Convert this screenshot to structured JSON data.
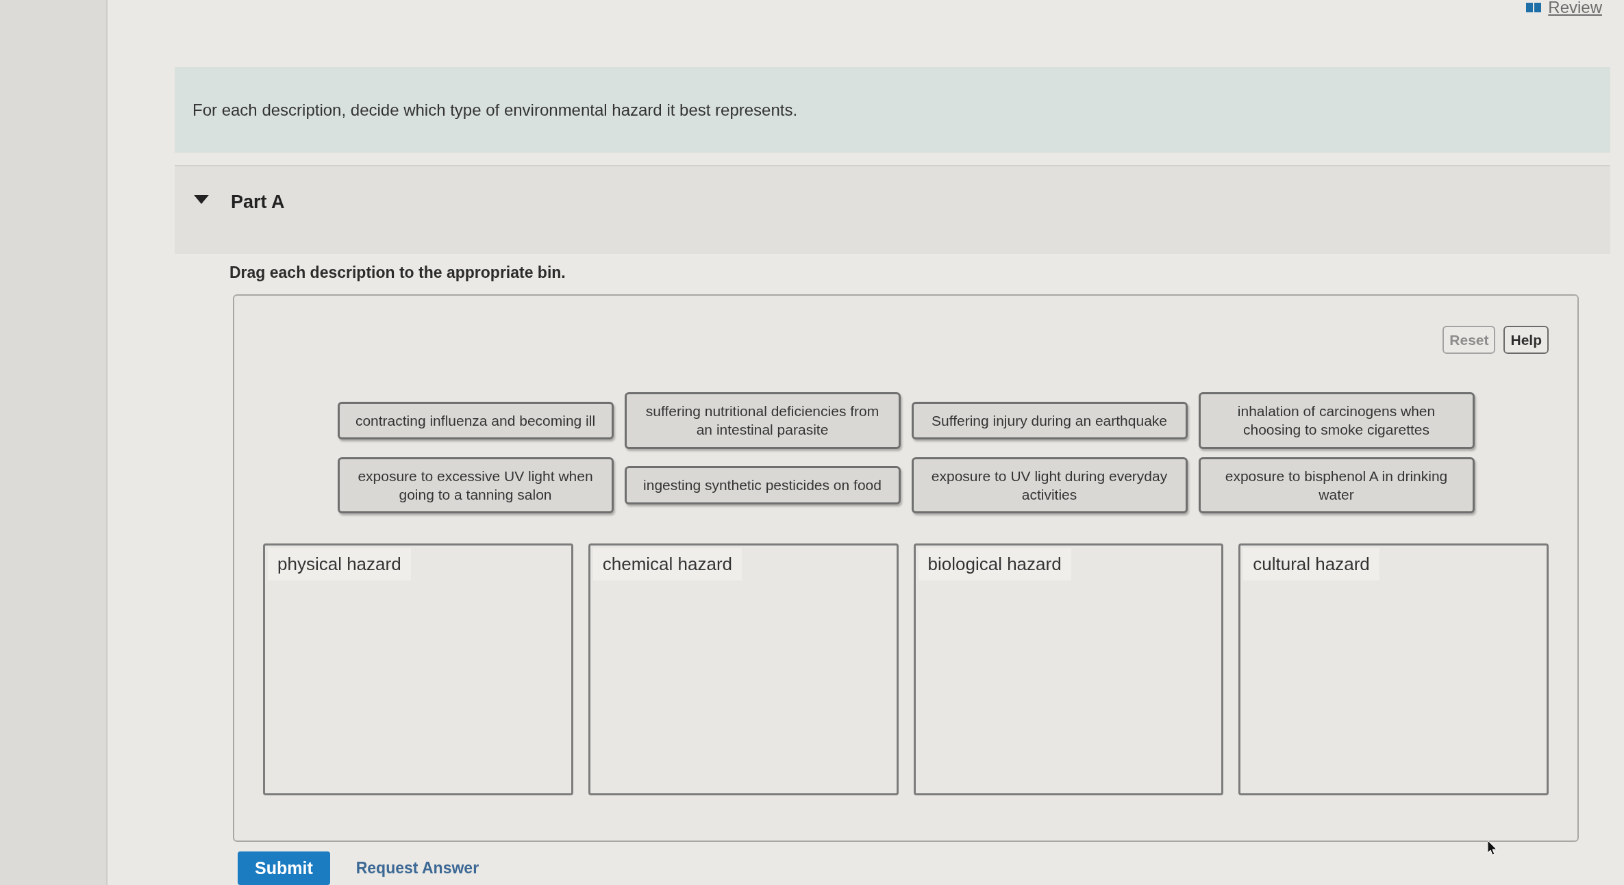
{
  "header": {
    "review_link": "Review"
  },
  "instructions": "For each description, decide which type of environmental hazard it best represents.",
  "part": {
    "title": "Part A",
    "expanded": true,
    "prompt": "Drag each description to the appropriate bin."
  },
  "drag_drop": {
    "buttons": [
      {
        "label": "Reset",
        "disabled": true
      },
      {
        "label": "Help",
        "disabled": false
      }
    ],
    "items": [
      "contracting influenza and becoming ill",
      "suffering nutritional deficiencies from an intestinal parasite",
      "Suffering injury during an earthquake",
      "inhalation of carcinogens when choosing to smoke cigarettes",
      "exposure to excessive UV light when going to a tanning salon",
      "ingesting synthetic pesticides on food",
      "exposure to UV light during everyday activities",
      "exposure to bisphenol A in drinking water"
    ],
    "bins": [
      {
        "label": "physical hazard"
      },
      {
        "label": "chemical hazard"
      },
      {
        "label": "biological hazard"
      },
      {
        "label": "cultural hazard"
      }
    ]
  },
  "actions": [
    {
      "kind": "primary",
      "label": "Submit"
    },
    {
      "kind": "link",
      "label": "Request Answer"
    }
  ]
}
